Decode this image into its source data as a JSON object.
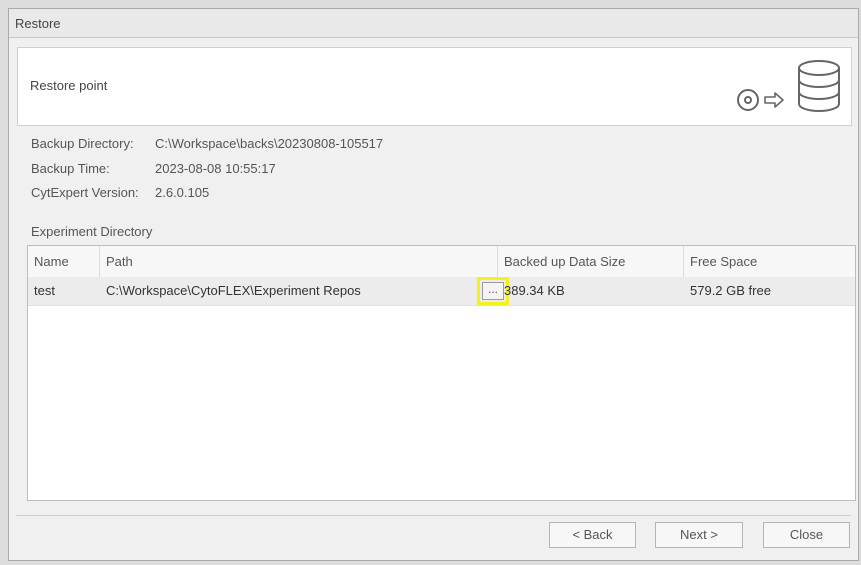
{
  "window": {
    "title": "Restore"
  },
  "header": {
    "title": "Restore point"
  },
  "info": {
    "backup_directory_label": "Backup Directory:",
    "backup_directory_value": "C:\\Workspace\\backs\\20230808-105517",
    "backup_time_label": "Backup Time:",
    "backup_time_value": "2023-08-08 10:55:17",
    "version_label": "CytExpert Version:",
    "version_value": "2.6.0.105"
  },
  "experiment_section_label": "Experiment Directory",
  "table": {
    "columns": [
      "Name",
      "Path",
      "Backed up Data Size",
      "Free Space"
    ],
    "rows": [
      {
        "name": "test",
        "path": "C:\\Workspace\\CytoFLEX\\Experiment Repos",
        "browse": "...",
        "size": "389.34 KB",
        "free": "579.2 GB free"
      }
    ]
  },
  "buttons": {
    "back": "< Back",
    "next": "Next >",
    "close": "Close"
  },
  "colors": {
    "highlight": "#f5f21a",
    "accent": "#f0f0f0"
  }
}
